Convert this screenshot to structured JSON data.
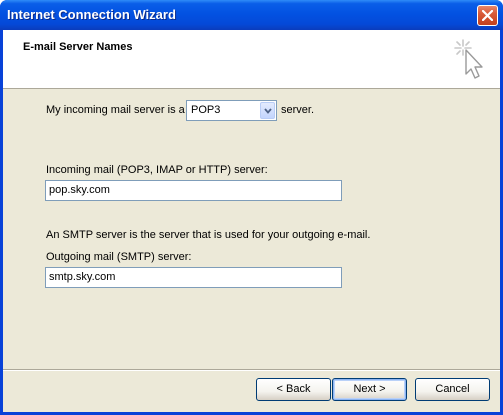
{
  "window": {
    "title": "Internet Connection Wizard"
  },
  "header": {
    "title": "E-mail Server Names"
  },
  "form": {
    "incoming_prefix": "My incoming mail server is a",
    "incoming_type": "POP3",
    "incoming_suffix": "server.",
    "incoming_label": "Incoming mail (POP3, IMAP or HTTP) server:",
    "incoming_value": "pop.sky.com",
    "smtp_note": "An SMTP server is the server that is used for your outgoing e-mail.",
    "outgoing_label": "Outgoing mail (SMTP) server:",
    "outgoing_value": "smtp.sky.com"
  },
  "buttons": {
    "back": "< Back",
    "next": "Next >",
    "cancel": "Cancel"
  },
  "icons": {
    "close": "close-icon",
    "dropdown": "chevron-down-icon",
    "wizard": "wizard-cursor-icon"
  },
  "colors": {
    "titlebar": "#0352e2",
    "client": "#ece9d8",
    "close": "#d85a38"
  }
}
